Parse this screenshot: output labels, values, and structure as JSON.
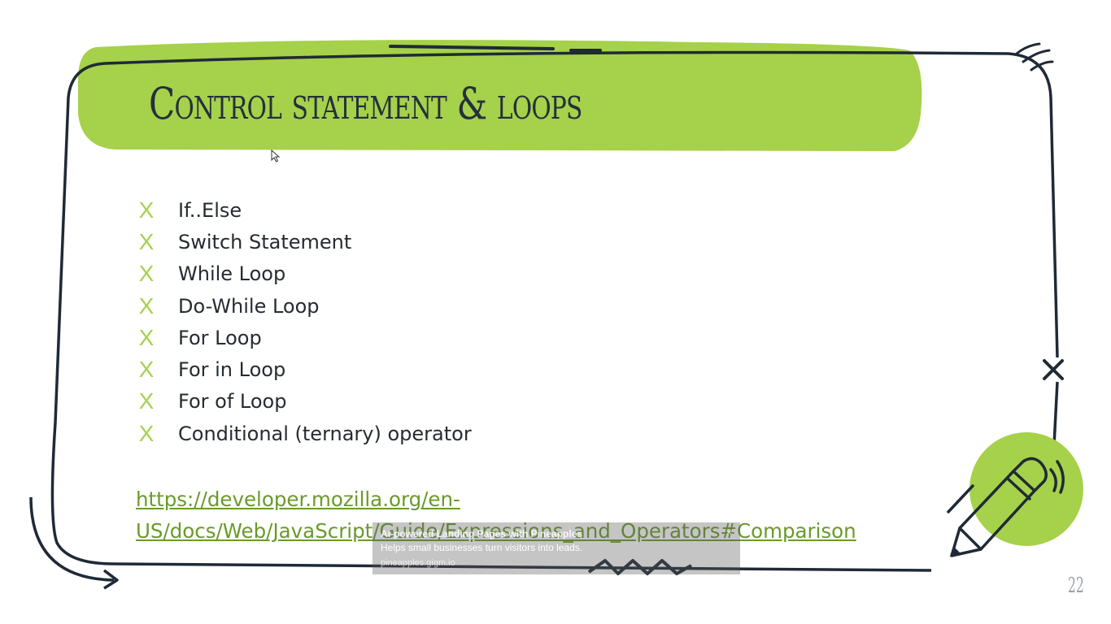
{
  "slide": {
    "title": "Control statement & loops",
    "page_number": "22",
    "bullet_marker": "X",
    "items": [
      "If..Else",
      "Switch Statement",
      "While Loop",
      "Do-While Loop",
      "For Loop",
      "For in Loop",
      "For of Loop",
      "Conditional (ternary) operator"
    ],
    "link": "https://developer.mozilla.org/en-US/docs/Web/JavaScript/Guide/Expressions_and_Operators#Comparison"
  },
  "ad_overlay": {
    "title": "AI-powered Landing Pages with Pineapples",
    "description": "Helps small businesses turn visitors into leads.",
    "url": "pineapples.gigm.io",
    "close": "×"
  },
  "colors": {
    "accent_green": "#a6d14a",
    "frame_dark": "#1f2a36",
    "link_green": "#6a9a2a"
  }
}
